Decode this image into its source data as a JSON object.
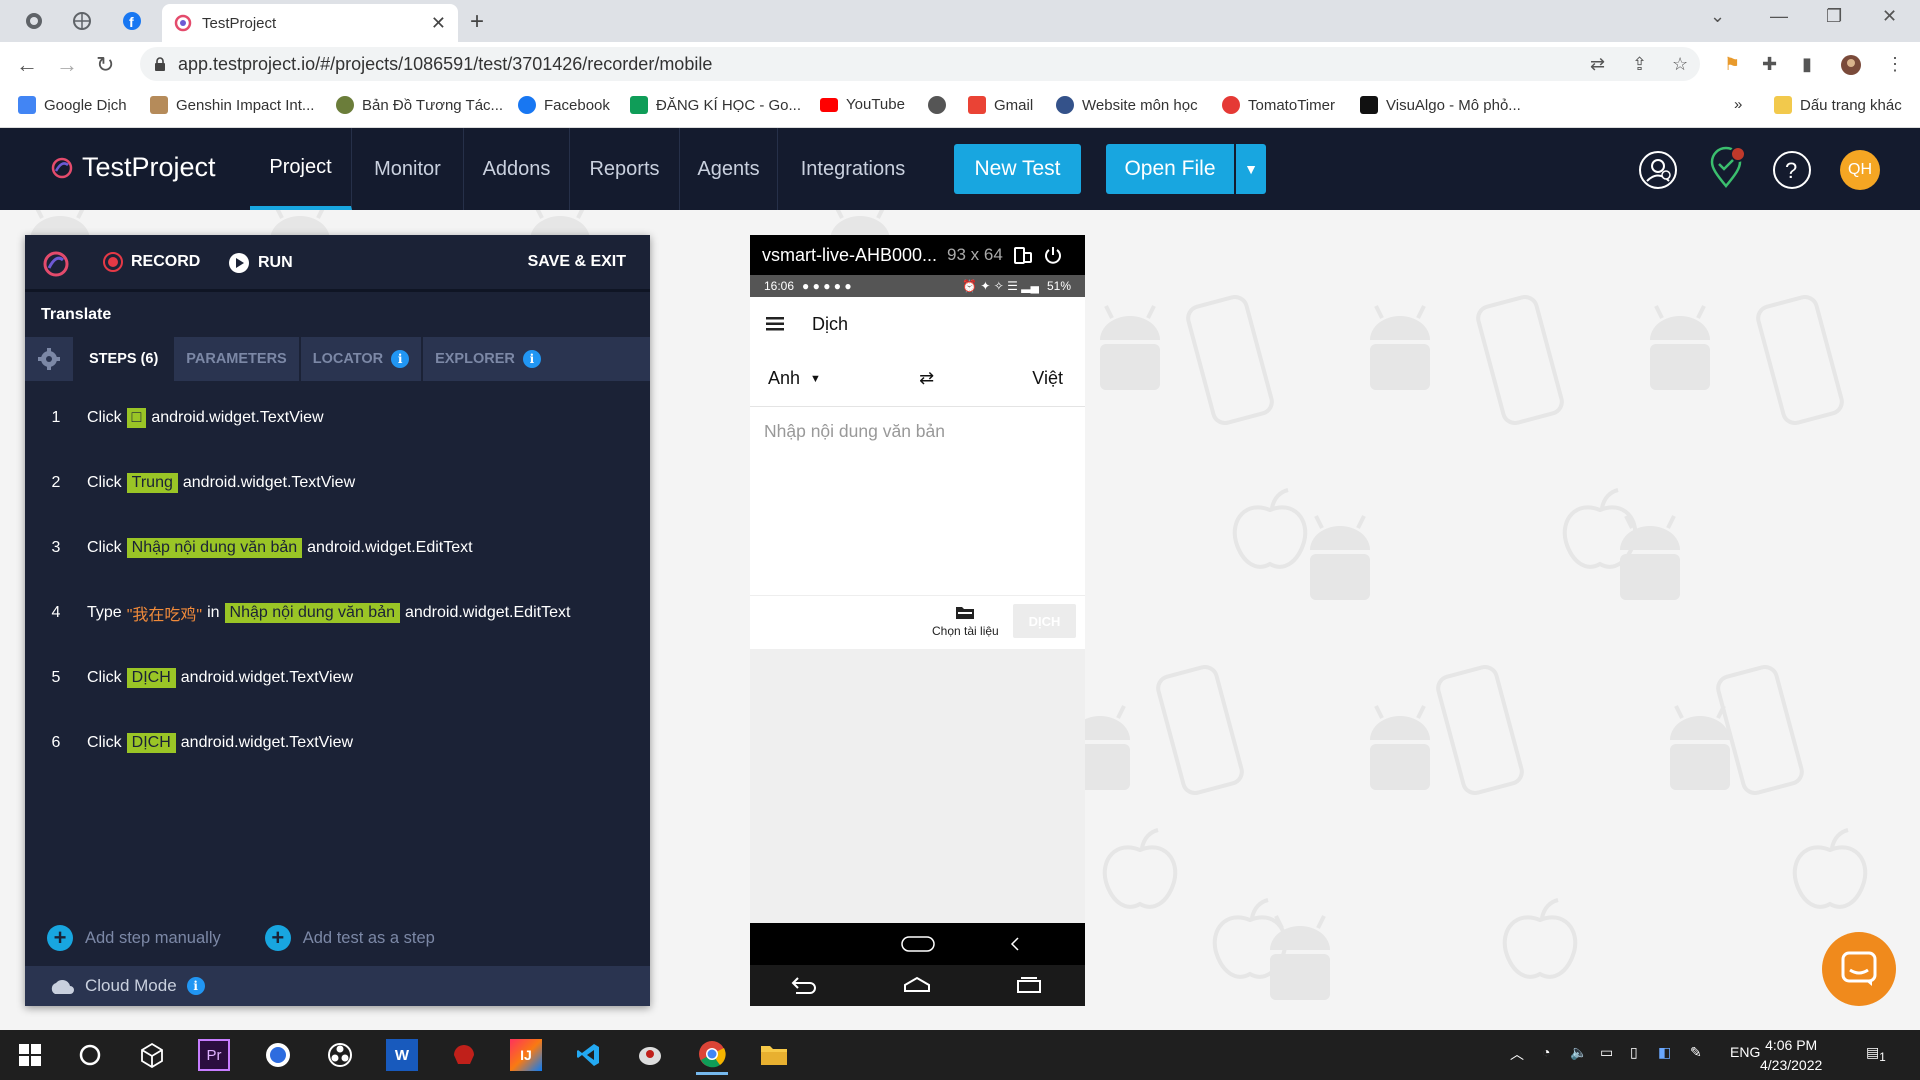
{
  "browser": {
    "tab_title": "TestProject",
    "url": "app.testproject.io/#/projects/1086591/test/3701426/recorder/mobile",
    "bookmarks": [
      {
        "label": "Google Dịch",
        "color": "#4285f4"
      },
      {
        "label": "Genshin Impact Int...",
        "color": "#b58b5a"
      },
      {
        "label": "Bản Đồ Tương Tác...",
        "color": "#6b7d3a"
      },
      {
        "label": "Facebook",
        "color": "#1877f2"
      },
      {
        "label": "ĐĂNG KÍ HỌC - Go...",
        "color": "#0f9d58"
      },
      {
        "label": "YouTube",
        "color": "#ff0000"
      },
      {
        "label": "",
        "color": "#555555"
      },
      {
        "label": "Gmail",
        "color": "#ea4335"
      },
      {
        "label": "Website môn học",
        "color": "#34528a"
      },
      {
        "label": "TomatoTimer",
        "color": "#e53935"
      },
      {
        "label": "VisuAlgo - Mô phỏ...",
        "color": "#111111"
      }
    ],
    "other_bookmarks": "Dấu trang khác",
    "more": "»"
  },
  "app": {
    "logo": "TestProject",
    "nav": [
      {
        "label": "Project",
        "active": true
      },
      {
        "label": "Monitor",
        "active": false
      },
      {
        "label": "Addons",
        "active": false
      },
      {
        "label": "Reports",
        "active": false
      },
      {
        "label": "Agents",
        "active": false
      },
      {
        "label": "Integrations",
        "active": false
      }
    ],
    "new_test": "New Test",
    "open_file": "Open File",
    "avatar": "QH",
    "accent": "#18a6e0"
  },
  "recorder": {
    "record": "RECORD",
    "run": "RUN",
    "save_exit": "SAVE & EXIT",
    "test_name": "Translate",
    "tabs": {
      "steps": "STEPS (6)",
      "parameters": "PARAMETERS",
      "locator": "LOCATOR",
      "explorer": "EXPLORER"
    },
    "steps": [
      {
        "num": "1",
        "action": "Click",
        "target": "□",
        "element": "android.widget.TextView"
      },
      {
        "num": "2",
        "action": "Click",
        "target": "Trung",
        "element": "android.widget.TextView"
      },
      {
        "num": "3",
        "action": "Click",
        "target": "Nhập nội dung văn bản",
        "element": "android.widget.EditText"
      },
      {
        "num": "4",
        "action": "Type",
        "value": "\"我在吃鸡\"",
        "in": "in",
        "target": "Nhập nội dung văn bản",
        "element": "android.widget.EditText"
      },
      {
        "num": "5",
        "action": "Click",
        "target": "DỊCH",
        "element": "android.widget.TextView"
      },
      {
        "num": "6",
        "action": "Click",
        "target": "DỊCH",
        "element": "android.widget.TextView"
      }
    ],
    "add_step": "Add step manually",
    "add_test": "Add test as a step",
    "cloud_mode": "Cloud Mode",
    "highlight_color": "#9ac526"
  },
  "device": {
    "name": "vsmart-live-AHB000...",
    "dims": "93 x 64",
    "time": "16:06",
    "battery": "51%",
    "app_title": "Dịch",
    "source_lang": "Anh",
    "target_lang": "Việt",
    "input_placeholder": "Nhập nội dung văn bản",
    "choose_doc": "Chọn tài liệu",
    "translate_btn": "DỊCH"
  },
  "taskbar": {
    "lang": "ENG",
    "time": "4:06 PM",
    "date": "4/23/2022",
    "notif_count": "1"
  }
}
